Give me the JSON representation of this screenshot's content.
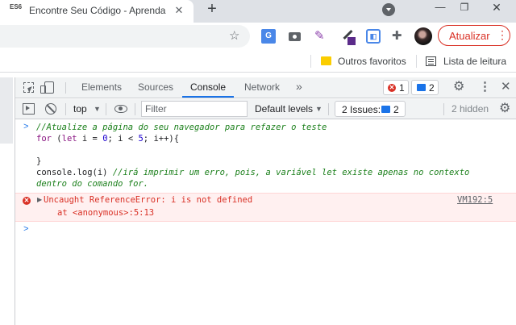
{
  "browser": {
    "tab": {
      "favicon_text": "ES6",
      "title": "Encontre Seu Código - Aprenda",
      "close": "✕"
    },
    "new_tab": "+",
    "window_controls": {
      "minimize": "—",
      "maximize": "❐",
      "close": "✕"
    },
    "extensions": {
      "translate_label": "G"
    },
    "update_button": {
      "label": "Atualizar",
      "menu": "⋮"
    },
    "bookmarks": {
      "other_favorites": "Outros favoritos",
      "reading_list": "Lista de leitura"
    }
  },
  "devtools": {
    "tabs": [
      {
        "label": "Elements"
      },
      {
        "label": "Sources"
      },
      {
        "label": "Console",
        "active": true
      },
      {
        "label": "Network"
      }
    ],
    "more_tabs": "»",
    "error_count": "1",
    "message_count": "2",
    "toolbar": {
      "context": "top",
      "context_caret": "▼",
      "filter_placeholder": "Filter",
      "levels": "Default levels",
      "levels_caret": "▼",
      "issues_label": "2 Issues:",
      "issues_count": "2",
      "hidden": "2 hidden"
    },
    "console": {
      "input_caret": ">",
      "lines": {
        "comment": "//Atualize a página do seu navegador para refazer o teste",
        "for_kw": "for",
        "for_open": " (",
        "let_kw": "let",
        "for_init": " i = ",
        "zero": "0",
        "for_cond": "; i < ",
        "five": "5",
        "for_end": "; i++){",
        "close_brace": "}",
        "log_call": "console.log(i) ",
        "log_comment_1": "//irá imprimir um erro, pois, a variável let existe apenas no contexto",
        "log_comment_2": "dentro do comando for."
      },
      "error": {
        "icon": "✕",
        "expand": "▶",
        "message": "Uncaught ReferenceError: i is not defined",
        "stack": "at <anonymous>:5:13",
        "source": "VM192:5"
      },
      "prompt": ">"
    }
  },
  "colors": {
    "accent": "#1a73e8",
    "error": "#d93025",
    "comment": "#1a7f1a",
    "keyword": "#881280"
  }
}
